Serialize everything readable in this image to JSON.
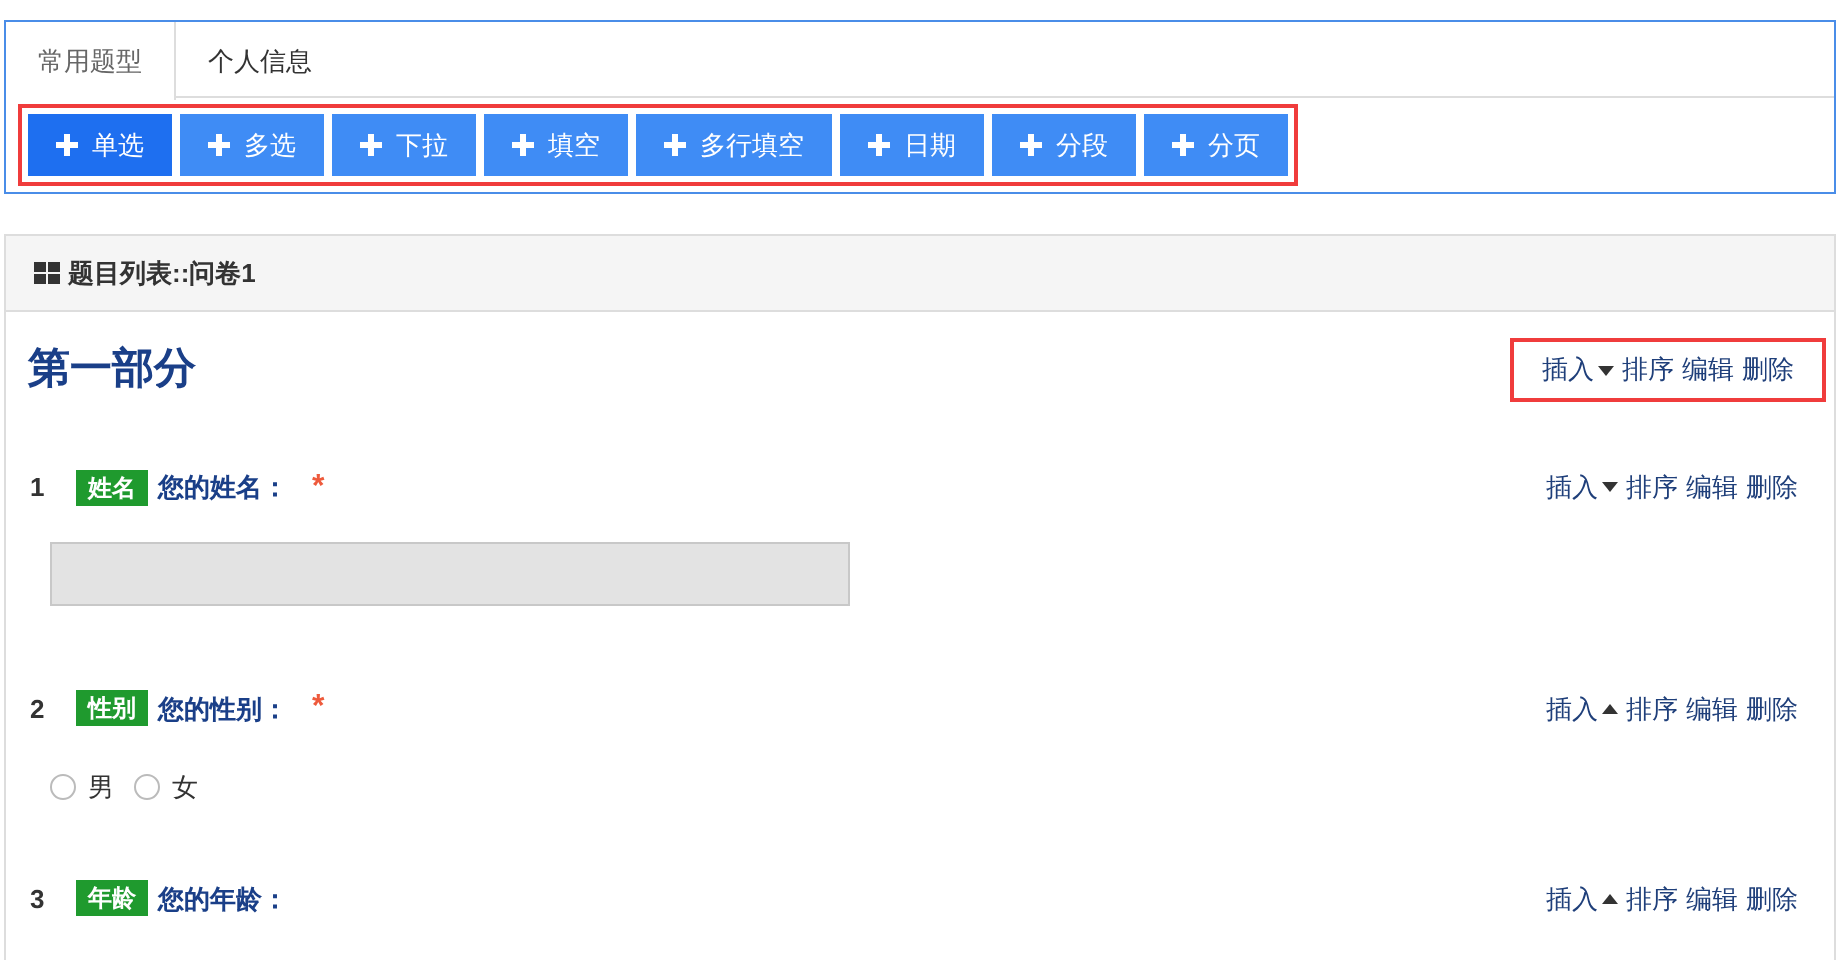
{
  "tabs": [
    {
      "label": "常用题型",
      "selected": true
    },
    {
      "label": "个人信息",
      "selected": false
    }
  ],
  "add_buttons": [
    {
      "label": "单选",
      "selected": true
    },
    {
      "label": "多选",
      "selected": false
    },
    {
      "label": "下拉",
      "selected": false
    },
    {
      "label": "填空",
      "selected": false
    },
    {
      "label": "多行填空",
      "selected": false
    },
    {
      "label": "日期",
      "selected": false
    },
    {
      "label": "分段",
      "selected": false
    },
    {
      "label": "分页",
      "selected": false
    }
  ],
  "list_panel": {
    "title": "题目列表::问卷1"
  },
  "section": {
    "title": "第一部分",
    "actions": {
      "insert": "插入",
      "insert_open": false,
      "sort": "排序",
      "edit": "编辑",
      "delete": "删除"
    }
  },
  "questions": [
    {
      "number": "1",
      "tag": "姓名",
      "title": "您的姓名：",
      "required_mark": "*",
      "kind": "text",
      "actions": {
        "insert": "插入",
        "insert_open": false,
        "sort": "排序",
        "edit": "编辑",
        "delete": "删除"
      }
    },
    {
      "number": "2",
      "tag": "性别",
      "title": "您的性别：",
      "required_mark": "*",
      "kind": "radio",
      "options": [
        {
          "label": "男",
          "selected": false
        },
        {
          "label": "女",
          "selected": false
        }
      ],
      "actions": {
        "insert": "插入",
        "insert_open": true,
        "sort": "排序",
        "edit": "编辑",
        "delete": "删除"
      }
    },
    {
      "number": "3",
      "tag": "年龄",
      "title": "您的年龄：",
      "kind": "none",
      "actions": {
        "insert": "插入",
        "insert_open": true,
        "sort": "排序",
        "edit": "编辑",
        "delete": "删除"
      }
    }
  ]
}
